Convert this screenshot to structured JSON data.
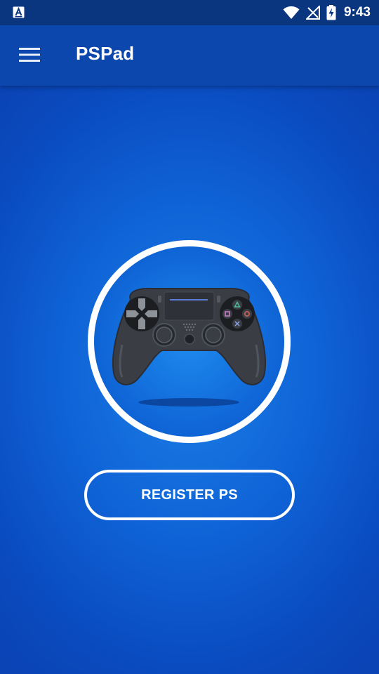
{
  "status_bar": {
    "time": "9:43",
    "icons": [
      "app-a-notification-icon",
      "wifi-icon",
      "no-signal-icon",
      "battery-charging-icon"
    ]
  },
  "app_bar": {
    "title": "PSPad",
    "menu_icon": "hamburger-menu-icon"
  },
  "main": {
    "illustration_icon": "game-controller-icon",
    "register_button_label": "REGISTER PS"
  },
  "colors": {
    "status_bar": "#0a3680",
    "app_bar": "#0b47ad",
    "background": "#0f63d6",
    "accent_white": "#ffffff",
    "controller_body": "#3a3d44"
  }
}
